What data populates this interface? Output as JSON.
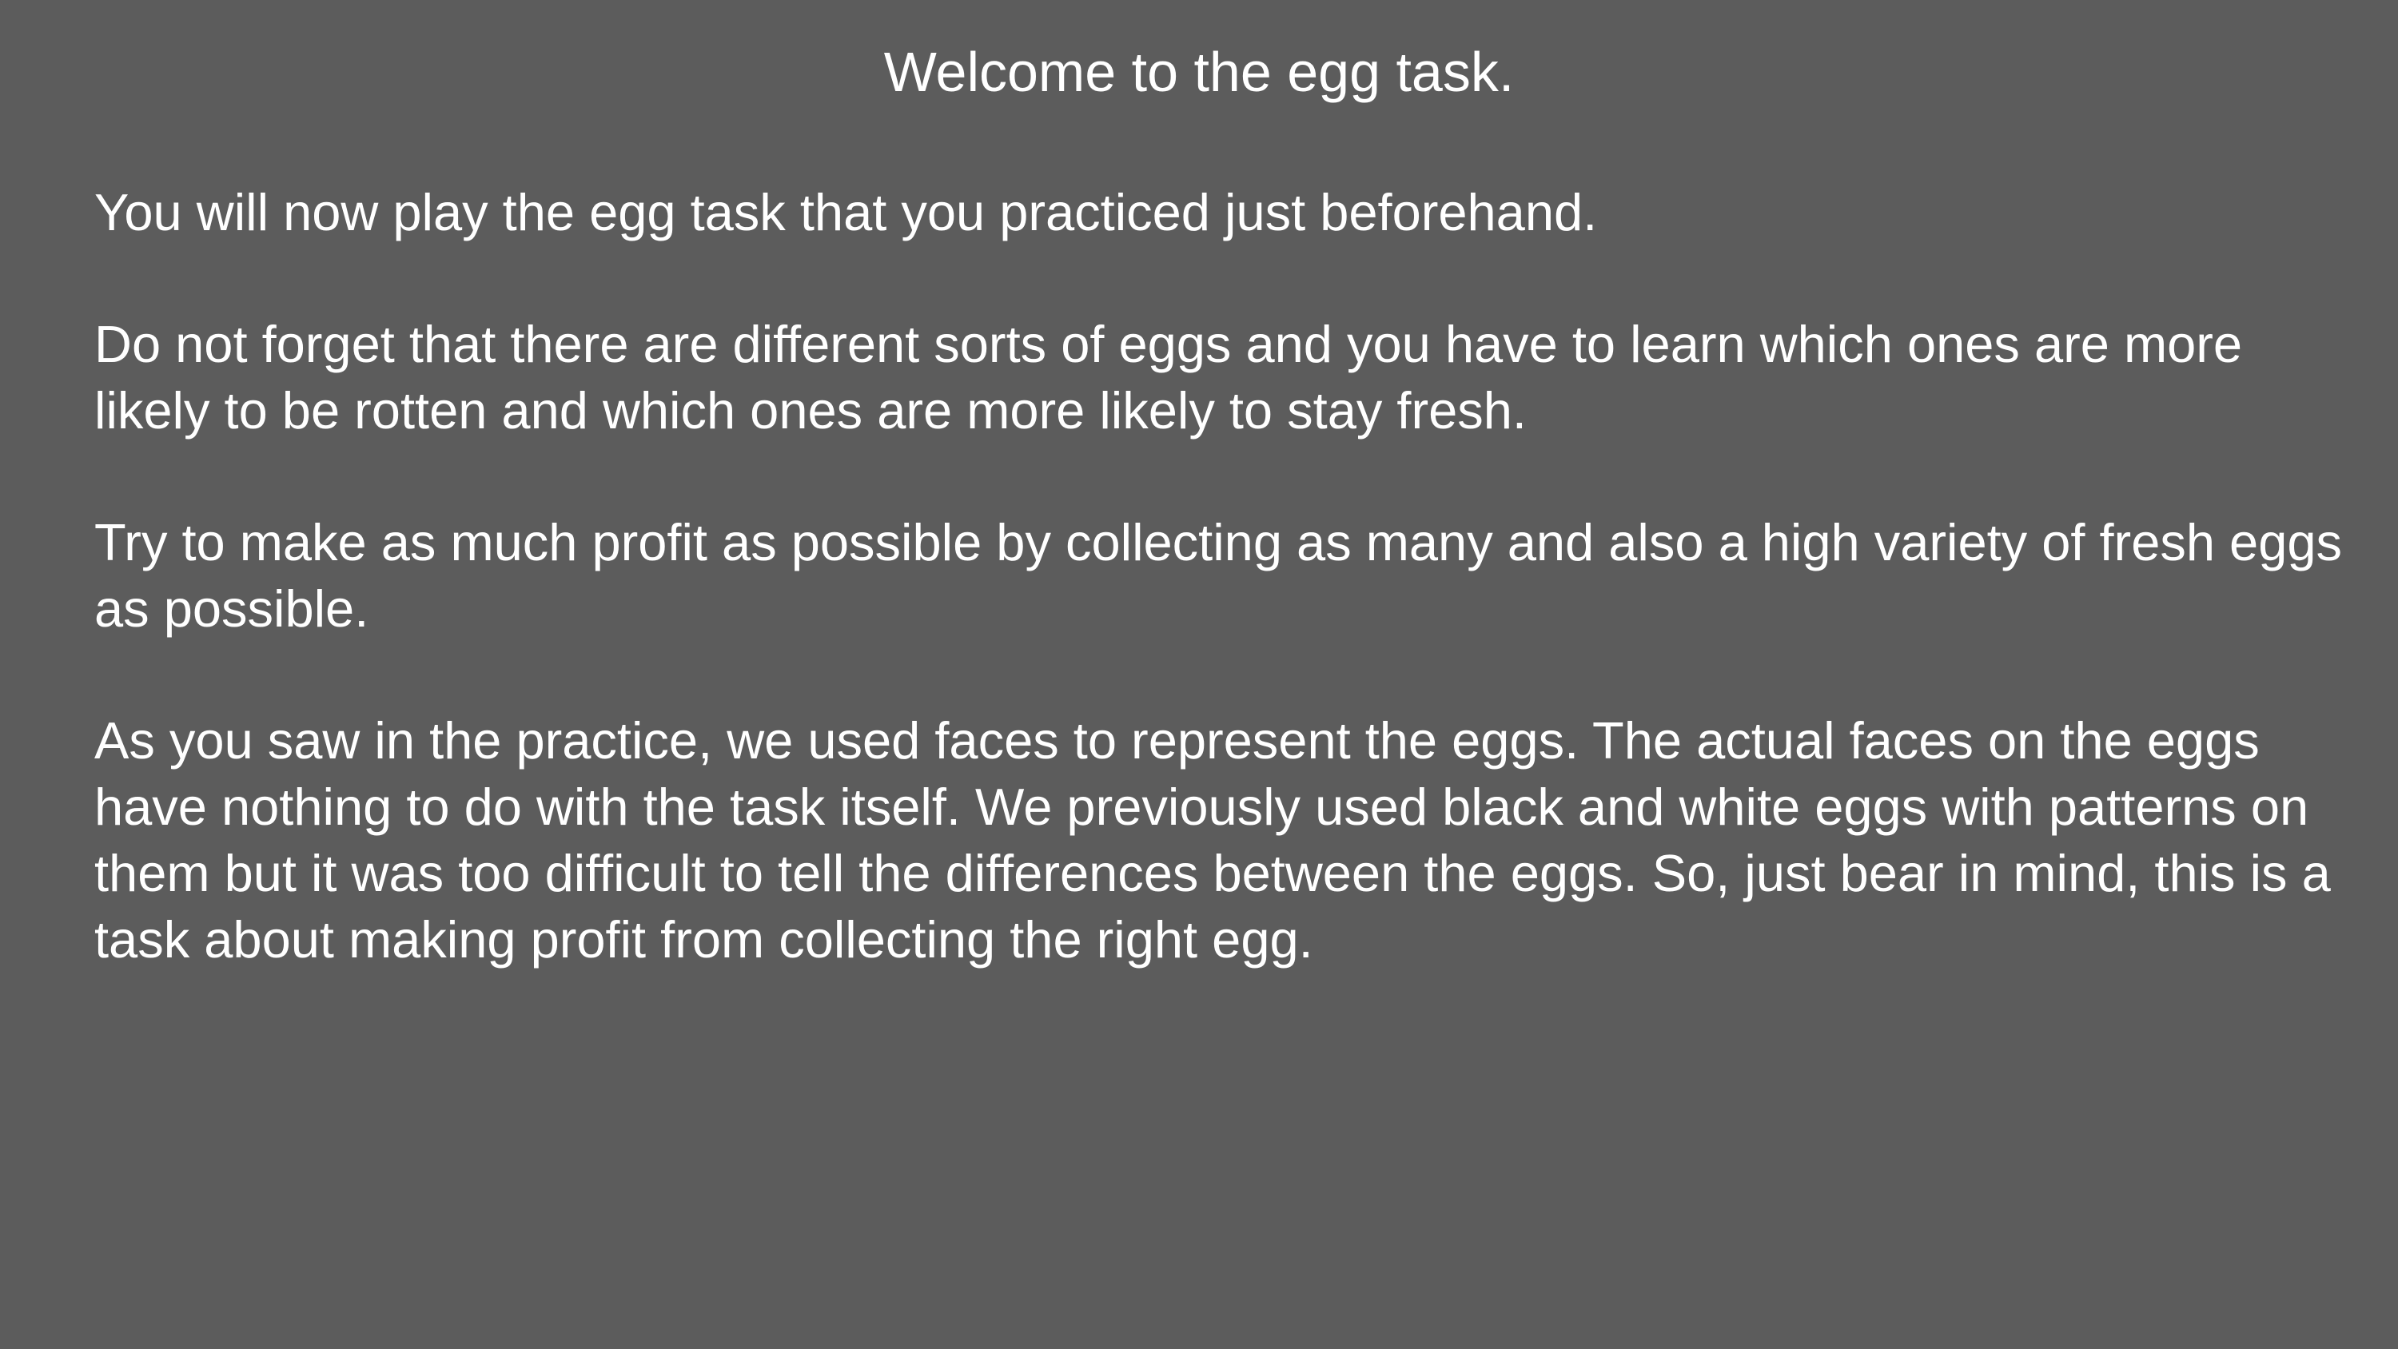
{
  "screen": {
    "title": "Welcome to the egg task.",
    "paragraphs": [
      "You will now play the egg task that you practiced just beforehand.",
      "Do not forget that there are different sorts of eggs and you have to learn which ones are more likely to be rotten and which ones are more likely to stay fresh.",
      "Try to make as much profit as possible by collecting as many and also a high variety of fresh eggs as possible.",
      "As you saw in the practice, we used faces to represent the eggs. The actual faces on the eggs have nothing to do with the task itself. We previously used black and white eggs with patterns on them but it was too difficult to tell the differences between the eggs. So, just bear in mind, this is a task about making profit from collecting the right egg."
    ]
  },
  "colors": {
    "background": "#5c5c5c",
    "text": "#ffffff"
  }
}
